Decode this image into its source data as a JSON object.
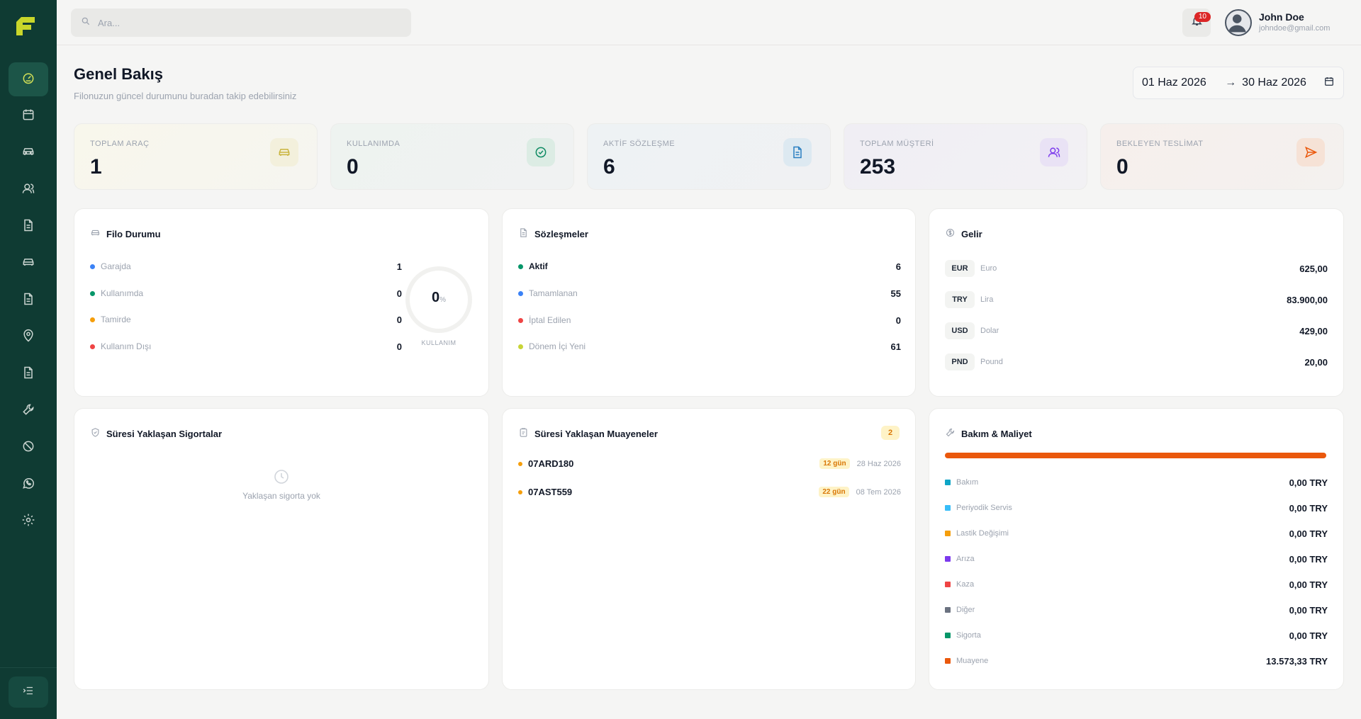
{
  "search": {
    "placeholder": "Ara..."
  },
  "notifications": {
    "count": "10"
  },
  "user": {
    "name": "John Doe",
    "email": "johndoe@gmail.com"
  },
  "header": {
    "title": "Genel Bakış",
    "subtitle": "Filonuzun güncel durumunu buradan takip edebilirsiniz"
  },
  "date_range": {
    "from": "01 Haz 2026",
    "to": "30 Haz 2026"
  },
  "sidebar": {
    "items": [
      {
        "icon": "gauge-icon",
        "active": true
      },
      {
        "icon": "calendar-icon"
      },
      {
        "icon": "car-icon"
      },
      {
        "icon": "users-icon"
      },
      {
        "icon": "document-icon"
      },
      {
        "icon": "car-icon"
      },
      {
        "icon": "document-icon"
      },
      {
        "icon": "map-pin-icon"
      },
      {
        "icon": "document-icon"
      },
      {
        "icon": "wrench-icon"
      },
      {
        "icon": "ban-icon"
      },
      {
        "icon": "whatsapp-icon"
      },
      {
        "icon": "gear-icon"
      }
    ]
  },
  "stats": [
    {
      "label": "TOPLAM ARAÇ",
      "value": "1",
      "icon": "car-icon",
      "color": "#c9b43c"
    },
    {
      "label": "KULLANIMDA",
      "value": "0",
      "icon": "check-circle-icon",
      "color": "#0d8a62"
    },
    {
      "label": "AKTİF SÖZLEŞME",
      "value": "6",
      "icon": "document-icon",
      "color": "#2a7fc1"
    },
    {
      "label": "TOPLAM MÜŞTERİ",
      "value": "253",
      "icon": "users-icon",
      "color": "#7c3aed"
    },
    {
      "label": "BEKLEYEN TESLİMAT",
      "value": "0",
      "icon": "send-icon",
      "color": "#ea580c"
    }
  ],
  "fleet": {
    "title": "Filo Durumu",
    "rows": [
      {
        "label": "Garajda",
        "value": "1",
        "color": "#3b82f6"
      },
      {
        "label": "Kullanımda",
        "value": "0",
        "color": "#059669"
      },
      {
        "label": "Tamirde",
        "value": "0",
        "color": "#f59e0b"
      },
      {
        "label": "Kullanım Dışı",
        "value": "0",
        "color": "#ef4444"
      }
    ],
    "gauge_value": "0",
    "gauge_unit": "%",
    "gauge_label": "KULLANIM"
  },
  "contracts": {
    "title": "Sözleşmeler",
    "rows": [
      {
        "label": "Aktif",
        "value": "6",
        "color": "#059669"
      },
      {
        "label": "Tamamlanan",
        "value": "55",
        "color": "#3b82f6"
      },
      {
        "label": "İptal Edilen",
        "value": "0",
        "color": "#ef4444"
      },
      {
        "label": "Dönem İçi Yeni",
        "value": "61",
        "color": "#c8d437"
      }
    ]
  },
  "income": {
    "title": "Gelir",
    "rows": [
      {
        "code": "EUR",
        "name": "Euro",
        "value": "625,00"
      },
      {
        "code": "TRY",
        "name": "Lira",
        "value": "83.900,00"
      },
      {
        "code": "USD",
        "name": "Dolar",
        "value": "429,00"
      },
      {
        "code": "PND",
        "name": "Pound",
        "value": "20,00"
      }
    ]
  },
  "insurance": {
    "title": "Süresi Yaklaşan Sigortalar",
    "empty": "Yaklaşan sigorta yok"
  },
  "inspections": {
    "title": "Süresi Yaklaşan Muayeneler",
    "count": "2",
    "rows": [
      {
        "plate": "07ARD180",
        "days": "12 gün",
        "date": "28 Haz 2026"
      },
      {
        "plate": "07AST559",
        "days": "22 gün",
        "date": "08 Tem 2026"
      }
    ]
  },
  "maintenance": {
    "title": "Bakım & Maliyet",
    "rows": [
      {
        "label": "Bakım",
        "value": "0,00 TRY",
        "color": "#0ea5c6"
      },
      {
        "label": "Periyodik Servis",
        "value": "0,00 TRY",
        "color": "#38bdf8"
      },
      {
        "label": "Lastik Değişimi",
        "value": "0,00 TRY",
        "color": "#f59e0b"
      },
      {
        "label": "Arıza",
        "value": "0,00 TRY",
        "color": "#7c3aed"
      },
      {
        "label": "Kaza",
        "value": "0,00 TRY",
        "color": "#ef4444"
      },
      {
        "label": "Diğer",
        "value": "0,00 TRY",
        "color": "#6b7280"
      },
      {
        "label": "Sigorta",
        "value": "0,00 TRY",
        "color": "#059669"
      },
      {
        "label": "Muayene",
        "value": "13.573,33 TRY",
        "color": "#ea580c"
      }
    ]
  }
}
